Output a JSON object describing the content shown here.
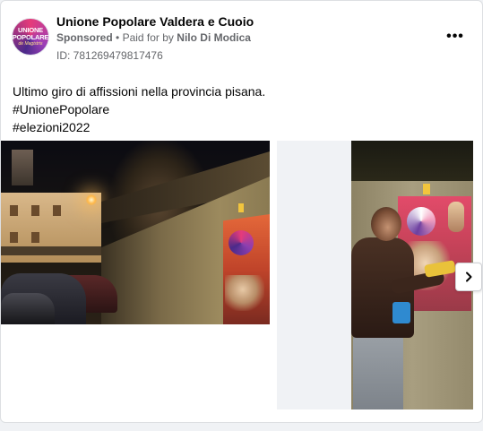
{
  "ad": {
    "page_name": "Unione Popolare Valdera e Cuoio",
    "sponsored_label": "Sponsored",
    "separator": "•",
    "paid_prefix": "Paid for by",
    "payer": "Nilo Di Modica",
    "id_label": "ID: 781269479817476",
    "avatar_text": {
      "line1": "UNIONE",
      "line2": "POPOLARE",
      "line3": "de Magistris"
    },
    "more_label": "•••"
  },
  "post": {
    "lines": [
      "Ultimo giro di affissioni nella provincia pisana.",
      "#UnionePopolare",
      "#elezioni2022"
    ]
  },
  "carousel": {
    "slides": [
      {
        "icon": "night-street-photo"
      },
      {
        "icon": "poster-hanging-photo"
      }
    ],
    "next_icon": "chevron-right-icon"
  },
  "colors": {
    "card_bg": "#ffffff",
    "muted_text": "#65676b",
    "text": "#050505"
  }
}
